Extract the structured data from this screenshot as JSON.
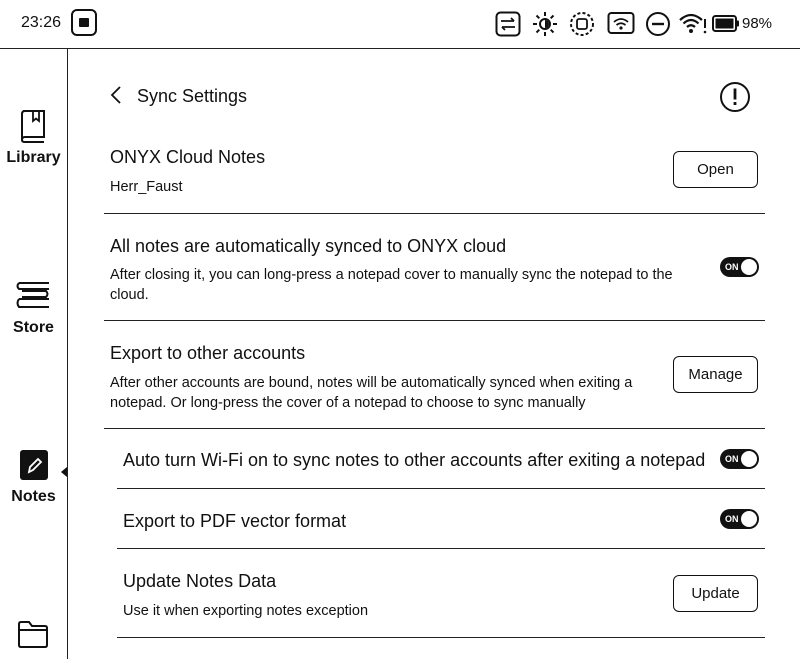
{
  "status_bar": {
    "time": "23:26",
    "battery": "98%",
    "icons": [
      "screen-record-icon",
      "refresh-mode-icon",
      "brightness-icon",
      "rotate-icon",
      "wifi-transfer-icon",
      "do-not-disturb-icon",
      "wifi-icon",
      "battery-icon"
    ]
  },
  "sidebar": {
    "items": [
      {
        "label": "Library",
        "icon": "book-icon"
      },
      {
        "label": "Store",
        "icon": "store-icon"
      },
      {
        "label": "Notes",
        "icon": "notes-icon",
        "selected": true
      },
      {
        "label": "",
        "icon": "folder-icon"
      }
    ]
  },
  "header": {
    "title": "Sync Settings"
  },
  "sections": {
    "cloud_notes": {
      "title": "ONYX Cloud Notes",
      "account": "Herr_Faust",
      "button": "Open"
    },
    "auto_sync": {
      "title": "All notes are automatically synced to ONYX cloud",
      "desc": "After closing it, you can long-press a notepad cover to manually sync the notepad to the cloud.",
      "toggle": "ON"
    },
    "export_accounts": {
      "title": "Export to other accounts",
      "desc": "After other accounts are bound, notes will be automatically synced when exiting a notepad. Or long-press the cover of a notepad to choose to sync manually",
      "button": "Manage"
    },
    "auto_wifi": {
      "title": "Auto turn Wi-Fi on to sync notes to other accounts after exiting a notepad",
      "toggle": "ON"
    },
    "pdf_vector": {
      "title": "Export to PDF vector format",
      "toggle": "ON"
    },
    "update_data": {
      "title": "Update Notes Data",
      "desc": "Use it when exporting notes exception",
      "button": "Update"
    }
  }
}
